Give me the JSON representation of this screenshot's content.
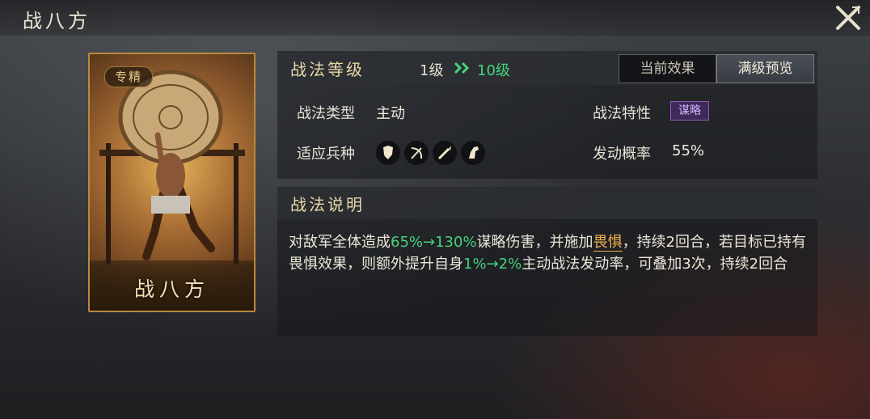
{
  "window": {
    "title": "战八方"
  },
  "card": {
    "badge": "专精",
    "name": "战八方"
  },
  "level": {
    "label": "战法等级",
    "from": "1级",
    "to": "10级"
  },
  "tabs": [
    {
      "label": "当前效果"
    },
    {
      "label": "满级预览"
    }
  ],
  "stats": {
    "type_label": "战法类型",
    "type_value": "主动",
    "trait_label": "战法特性",
    "trait_value": "谋略",
    "units_label": "适应兵种",
    "units": [
      "shield-icon",
      "bow-icon",
      "spear-icon",
      "horse-icon"
    ],
    "rate_label": "发动概率",
    "rate_value": "55%"
  },
  "description": {
    "title": "战法说明",
    "p1": "对敌军全体造成",
    "dmg": "65%→130%",
    "p2": "谋略伤害，并施加",
    "status": "畏惧",
    "p3": "，持续2回合，若目标已持有畏惧效果，则额外提升自身",
    "bonus": "1%→2%",
    "p4": "主动战法发动率，可叠加3次，持续2回合"
  },
  "colors": {
    "accent_green": "#47d27b",
    "gold": "#e9d9a8",
    "status_orange": "#f0b24a",
    "trait_purple": "#8a5db8"
  }
}
